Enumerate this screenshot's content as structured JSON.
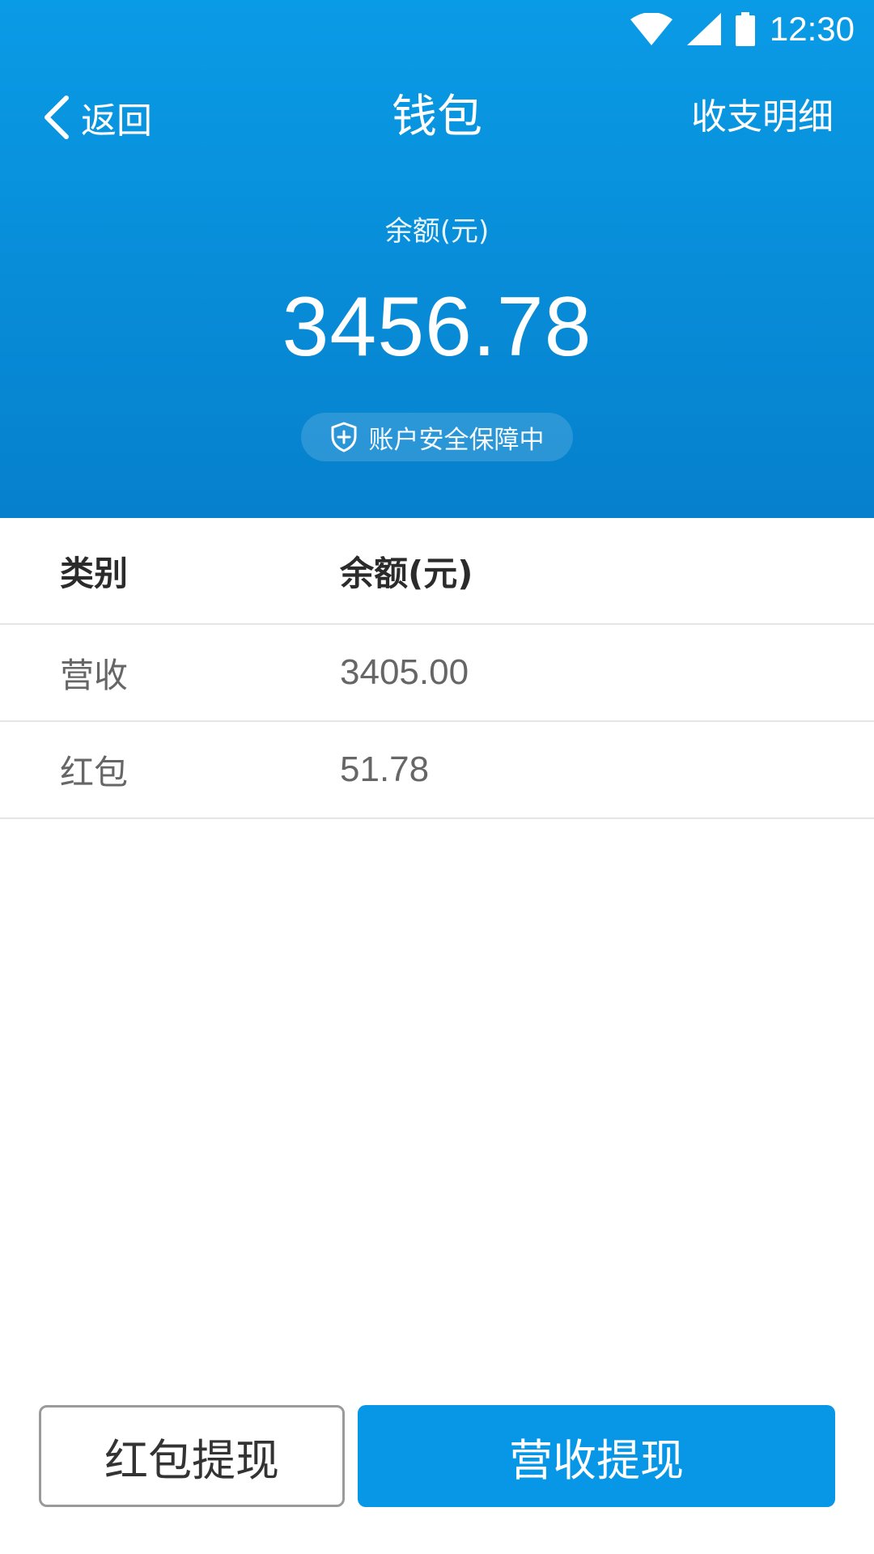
{
  "status_bar": {
    "time": "12:30",
    "icons": [
      "wifi-icon",
      "signal-icon",
      "battery-icon"
    ]
  },
  "nav": {
    "back_label": "返回",
    "title": "钱包",
    "right_label": "收支明细"
  },
  "balance": {
    "label": "余额(元)",
    "amount": "3456.78",
    "safety_text": "账户安全保障中"
  },
  "table": {
    "headers": [
      "类别",
      "余额(元)"
    ],
    "rows": [
      {
        "category": "营收",
        "amount": "3405.00"
      },
      {
        "category": "红包",
        "amount": "51.78"
      }
    ]
  },
  "actions": {
    "redpacket_withdraw": "红包提现",
    "revenue_withdraw": "营收提现"
  },
  "colors": {
    "primary": "#0797e6",
    "header_top": "#0a9be6",
    "header_bottom": "#0680cc"
  }
}
